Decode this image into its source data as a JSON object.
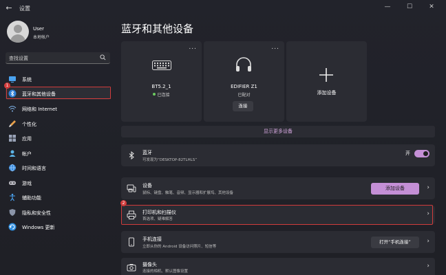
{
  "app": {
    "title": "设置"
  },
  "window": {
    "minimize": "—",
    "maximize": "☐",
    "close": "✕",
    "back": "←"
  },
  "user": {
    "name": "User",
    "account": "本地帐户"
  },
  "search": {
    "placeholder": "查找设置"
  },
  "sidebar": {
    "items": [
      {
        "label": "系统",
        "icon": "monitor-icon"
      },
      {
        "label": "蓝牙和其他设备",
        "icon": "bluetooth-icon",
        "active": true
      },
      {
        "label": "网络和 Internet",
        "icon": "wifi-icon"
      },
      {
        "label": "个性化",
        "icon": "brush-icon"
      },
      {
        "label": "应用",
        "icon": "apps-icon"
      },
      {
        "label": "帐户",
        "icon": "account-icon"
      },
      {
        "label": "时间和语言",
        "icon": "globe-icon"
      },
      {
        "label": "游戏",
        "icon": "gamepad-icon"
      },
      {
        "label": "辅助功能",
        "icon": "accessibility-icon"
      },
      {
        "label": "隐私和安全性",
        "icon": "shield-icon"
      },
      {
        "label": "Windows 更新",
        "icon": "update-icon"
      }
    ]
  },
  "annotations": {
    "badge1": "1",
    "badge2": "2"
  },
  "main": {
    "title": "蓝牙和其他设备",
    "cards": [
      {
        "name": "BT5.2_1",
        "status": "已连接",
        "more": "...",
        "icon": "keyboard-icon"
      },
      {
        "name": "EDIFIER Z1",
        "status": "已配对",
        "more": "...",
        "icon": "headset-icon",
        "button": "连接"
      },
      {
        "name": "添加设备",
        "icon": "plus-icon"
      }
    ],
    "show_more": "显示更多设备",
    "bluetooth": {
      "title": "蓝牙",
      "subtitle": "可发现为“DESKTOP-82TLHLS”",
      "toggle_label": "开",
      "toggle_on": true
    },
    "rows": [
      {
        "title": "设备",
        "subtitle": "鼠标、键盘、触笔、音频、显示器和扩展坞、其他设备",
        "button": "添加设备",
        "icon": "devices-icon"
      },
      {
        "title": "打印机和扫描仪",
        "subtitle": "首选项、疑难解答",
        "icon": "printer-icon"
      },
      {
        "title": "手机连接",
        "subtitle": "立即从你的 Android 设备访问照片、短信等",
        "button": "打开“手机连接”",
        "icon": "phone-icon"
      },
      {
        "title": "摄像头",
        "subtitle": "连接的相机、默认图像设置",
        "icon": "camera-icon"
      }
    ]
  },
  "colors": {
    "accent": "#c48fd6",
    "annotation": "#d23c3c",
    "card": "#2b2c33",
    "background": "#202020"
  }
}
